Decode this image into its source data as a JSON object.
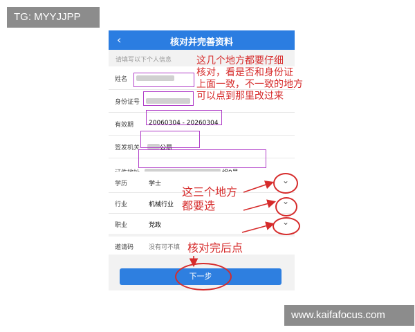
{
  "watermarks": {
    "top_left": "TG: MYYJJPP",
    "bottom_right": "www.kaifafocus.com"
  },
  "header": {
    "back_icon": "‹",
    "title": "核对并完善资料"
  },
  "hint": "请填写以下个人信息",
  "fields": {
    "name_label": "姓名",
    "idnum_label": "身份证号",
    "validity_label": "有效期",
    "validity_value": "20060304 - 20260304",
    "authority_label": "签发机关",
    "authority_value": "公局",
    "address_label": "证件地址",
    "address_value": "组9号"
  },
  "selectors": {
    "education_label": "学历",
    "education_value": "学士",
    "industry_label": "行业",
    "industry_value": "机械行业",
    "occupation_label": "职业",
    "occupation_value": "党政"
  },
  "invite": {
    "label": "邀请码",
    "placeholder": "没有可不填"
  },
  "next_button": "下一步",
  "annotations": {
    "note1_line1": "这几个地方都要仔细",
    "note1_line2": "核对，看是否和身份证",
    "note1_line3": "上面一致，不一致的地方",
    "note1_line4": "可以点到那里改过来",
    "note2_line1": "这三个地方",
    "note2_line2": "都要选",
    "note3": "核对完后点"
  },
  "colors": {
    "primary": "#2b7de1",
    "annotation": "#d62b2b",
    "highlight": "#b03cc8"
  }
}
